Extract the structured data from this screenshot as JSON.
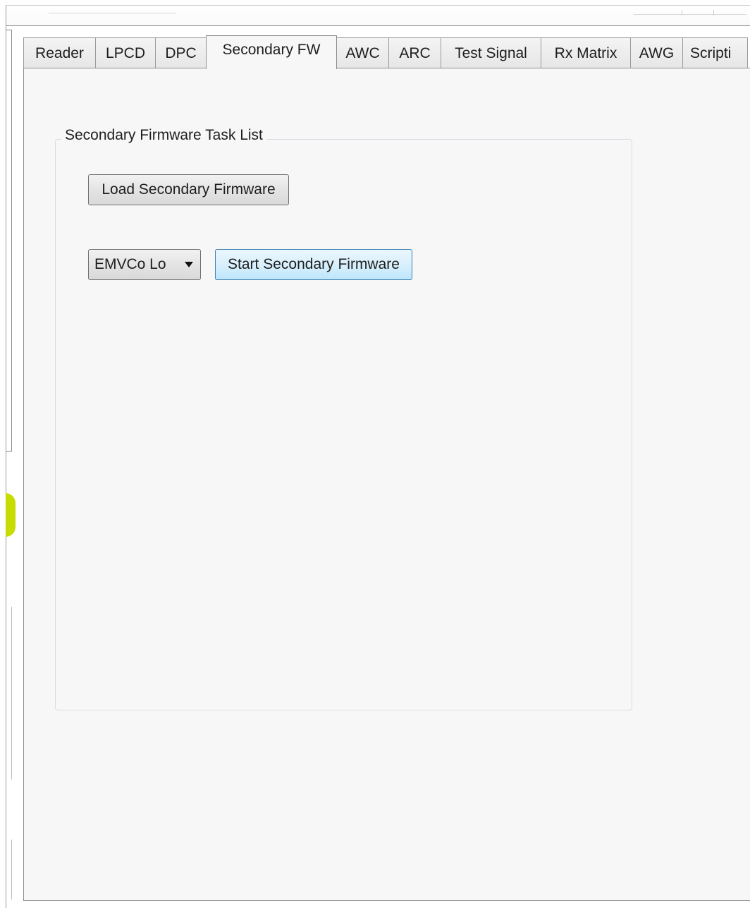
{
  "tabs": [
    {
      "label": "Reader"
    },
    {
      "label": "LPCD"
    },
    {
      "label": "DPC"
    },
    {
      "label": "Secondary FW"
    },
    {
      "label": "AWC"
    },
    {
      "label": "ARC"
    },
    {
      "label": "Test Signal"
    },
    {
      "label": "Rx Matrix"
    },
    {
      "label": "AWG"
    },
    {
      "label": "Scripti"
    }
  ],
  "active_tab": "Secondary FW",
  "panel": {
    "group_title": "Secondary Firmware Task List",
    "load_button": "Load Secondary Firmware",
    "mode_select": {
      "selected": "EMVCo Lo"
    },
    "start_button": "Start Secondary Firmware"
  },
  "colors": {
    "accent": "#c7dc00",
    "hover_button": "#bee6fd"
  },
  "icons": {
    "dropdown": "chevron-down-icon"
  }
}
